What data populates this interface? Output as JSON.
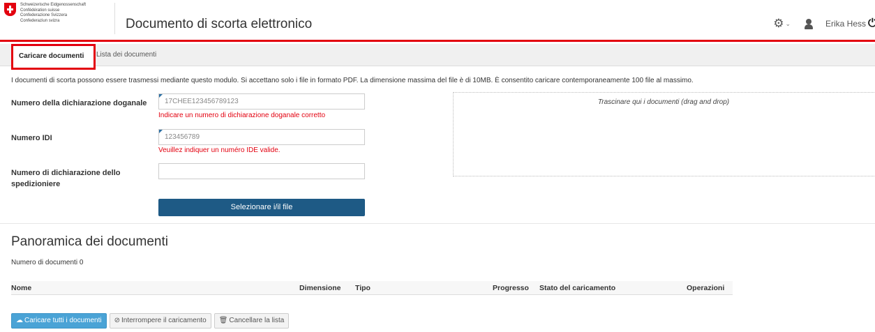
{
  "header": {
    "logo_lines": [
      "Schweizerische Eidgenossenschaft",
      "Confédération suisse",
      "Confederazione Svizzera",
      "Confederaziun svizra"
    ],
    "title": "Documento di scorta elettronico",
    "user_name": "Erika Hess",
    "icons": [
      "gear-icon",
      "chevron-down-icon",
      "user-icon",
      "power-icon"
    ]
  },
  "tabs": [
    {
      "label": "Caricare documenti",
      "active": true
    },
    {
      "label": "Lista dei documenti",
      "active": false
    }
  ],
  "info_text": "I documenti di scorta possono essere trasmessi mediante questo modulo. Si accettano solo i file in formato PDF. La dimensione massima del file è di 10MB. È consentito caricare contemporaneamente 100 file al massimo.",
  "form": {
    "customs_label": "Numero della dichiarazione doganale",
    "customs_value": "17CHEE123456789123",
    "customs_error": "Indicare un numero di dichiarazione doganale corretto",
    "idi_label": "Numero IDI",
    "idi_value": "123456789",
    "idi_error": "Veuillez indiquer un numéro IDE valide.",
    "forwarder_label": "Numero di dichiarazione dello spedizioniere",
    "forwarder_value": "",
    "select_button": "Selezionare i/il file",
    "drop_text": "Trascinare qui i documenti (drag and drop)"
  },
  "overview": {
    "title": "Panoramica dei documenti",
    "count_text": "Numero di documenti 0",
    "columns": [
      "Nome",
      "Dimensione",
      "Tipo",
      "Progresso",
      "Stato del caricamento",
      "Operazioni"
    ]
  },
  "actions": {
    "upload_all": "Caricare tutti i documenti",
    "stop_upload": "Interrompere il caricamento",
    "clear_list": "Cancellare la lista"
  },
  "colors": {
    "accent_red": "#e3000f",
    "primary_blue": "#1e5a85",
    "upload_blue": "#4aa3d6"
  }
}
